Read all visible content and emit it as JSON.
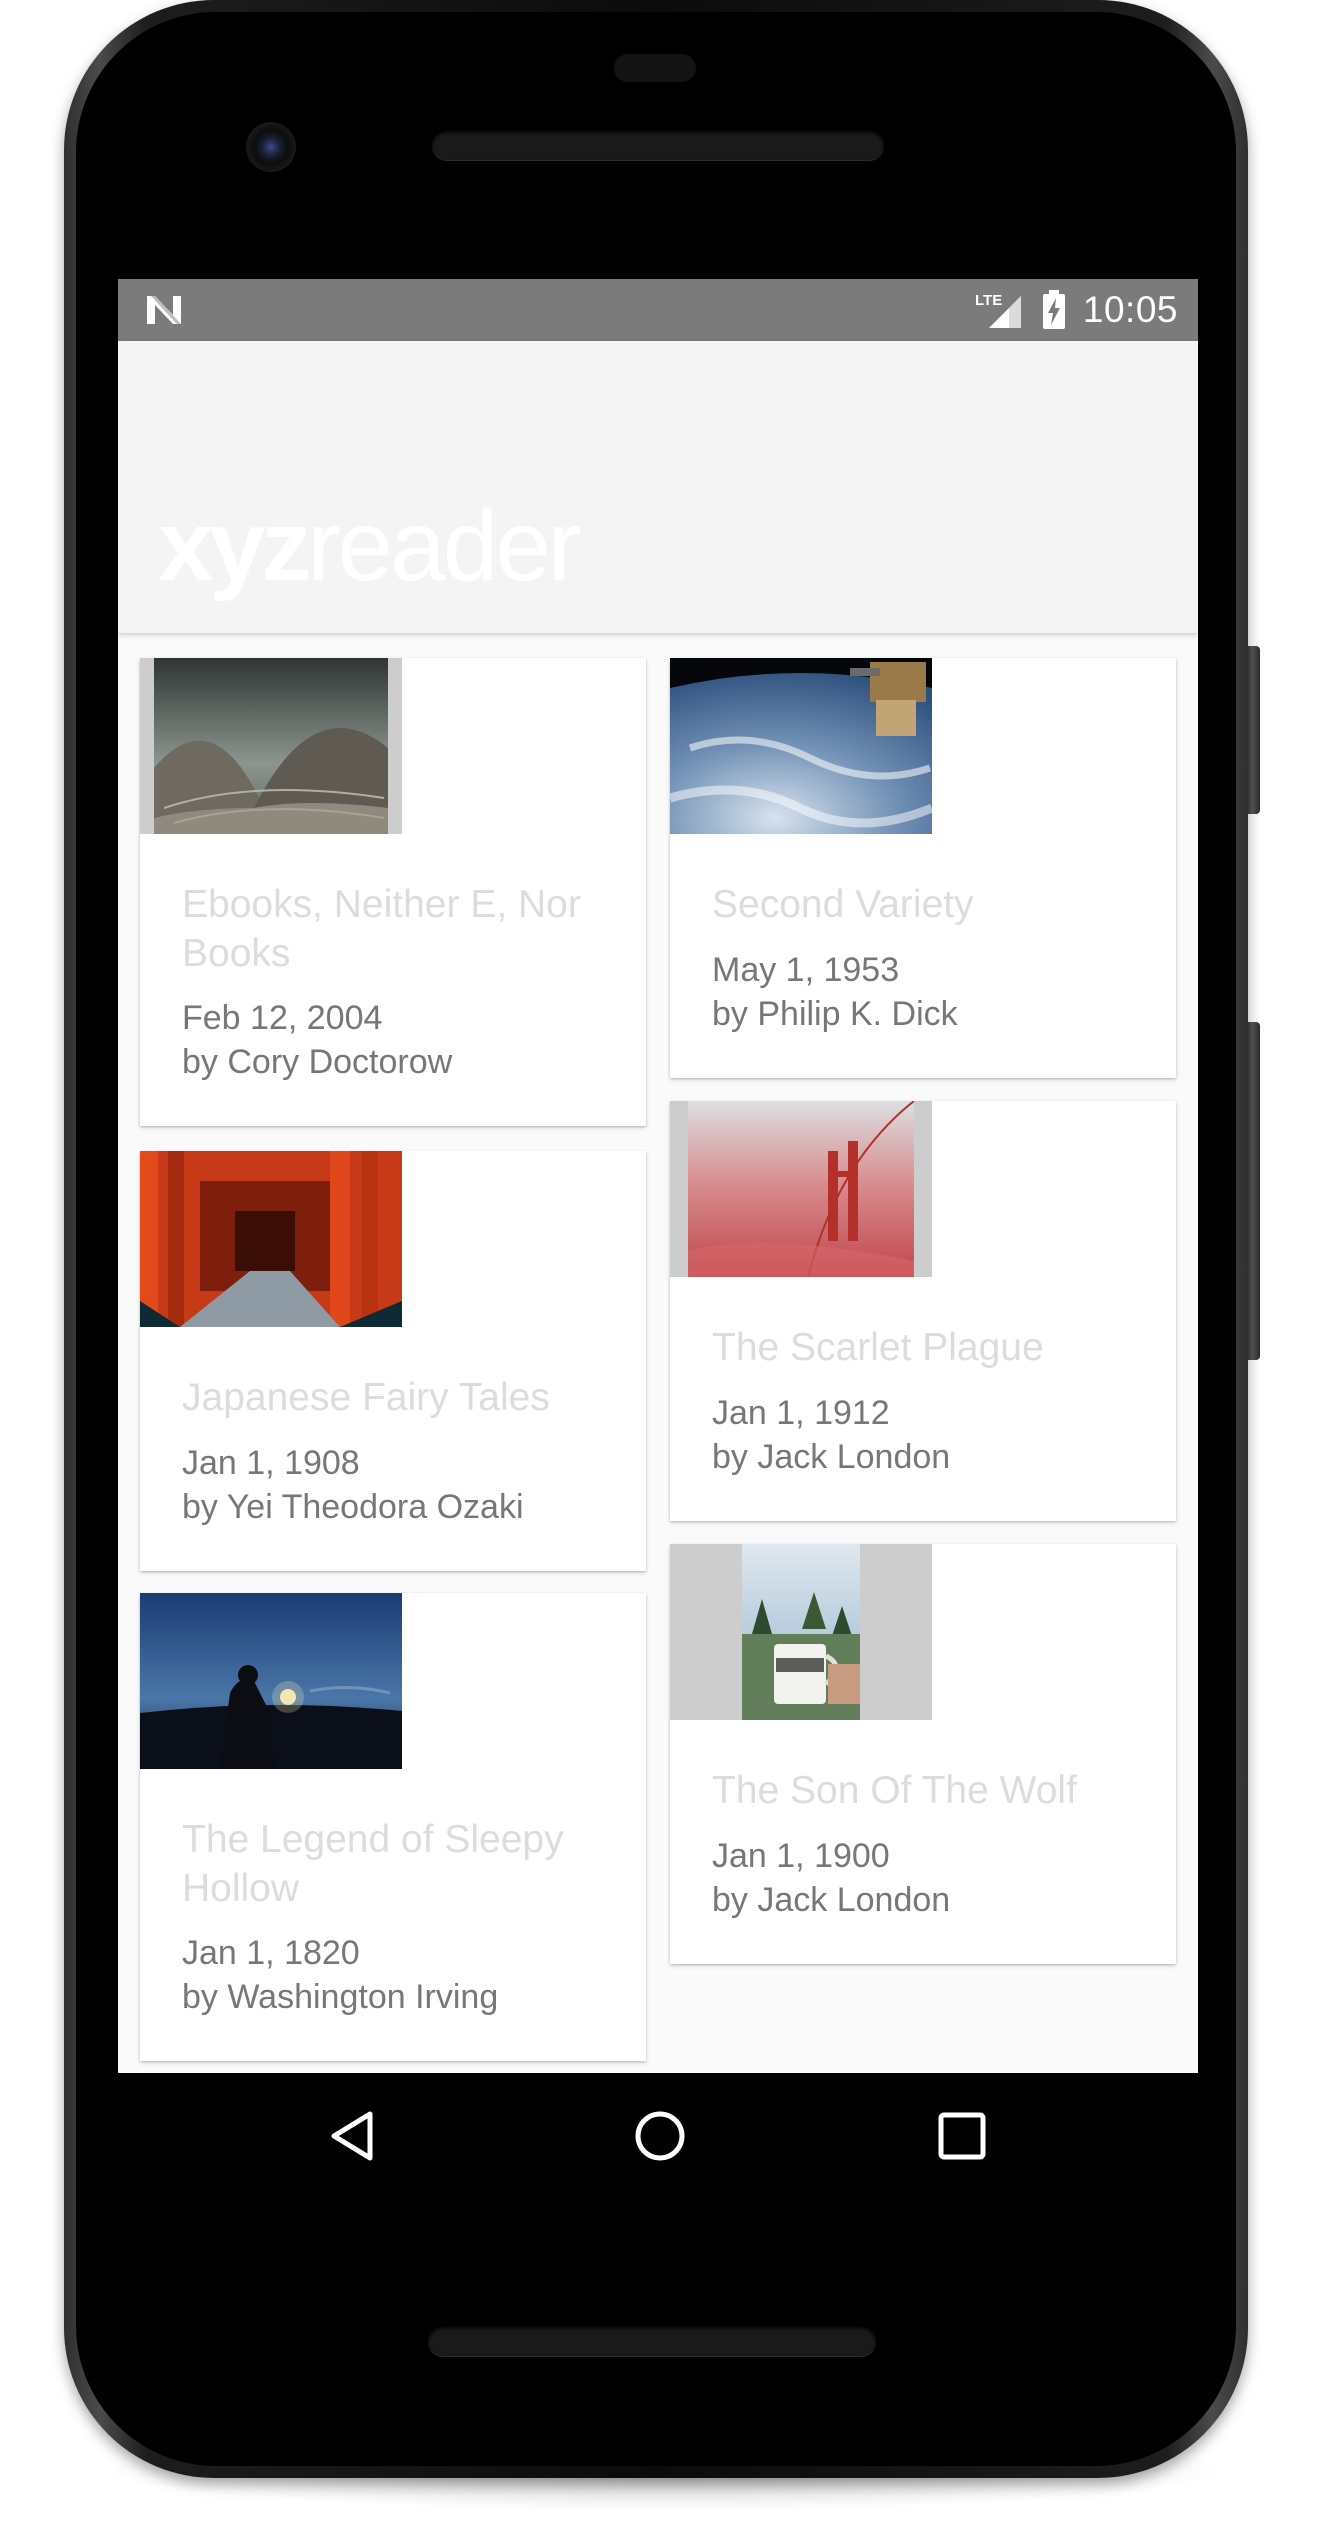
{
  "status_bar": {
    "time": "10:05",
    "network_label": "LTE",
    "icons": [
      "notification-n-icon",
      "lte-signal-icon",
      "battery-charging-icon"
    ]
  },
  "app": {
    "logo_bold": "xyz",
    "logo_light": "reader"
  },
  "articles": [
    {
      "title": "Ebooks, Neither E, Nor Books",
      "date": "Feb 12, 2004",
      "author": "by Cory Doctorow",
      "image": "concrete-shell-roof"
    },
    {
      "title": "Second Variety",
      "date": "May 1, 1953",
      "author": "by Philip K. Dick",
      "image": "earth-from-orbit"
    },
    {
      "title": "Japanese Fairy Tales",
      "date": "Jan 1, 1908",
      "author": "by Yei Theodora Ozaki",
      "image": "torii-gates-path"
    },
    {
      "title": "The Scarlet Plague",
      "date": "Jan 1, 1912",
      "author": "by Jack London",
      "image": "bridge-in-red-fog"
    },
    {
      "title": "The Legend of Sleepy Hollow",
      "date": "Jan 1, 1820",
      "author": "by Washington Irving",
      "image": "lantern-at-dusk"
    },
    {
      "title": "The Son Of The Wolf",
      "date": "Jan 1, 1900",
      "author": "by Jack London",
      "image": "camping-mug-by-lake"
    }
  ],
  "navigation": {
    "icons": [
      "back-icon",
      "home-icon",
      "recents-icon"
    ]
  },
  "colors": {
    "status_bar": "#7b7b7b",
    "app_bar": "#f4f4f4",
    "screen_background": "#fafafa",
    "card": "#ffffff",
    "title_text": "#dcdcdc",
    "meta_text": "#777777"
  }
}
